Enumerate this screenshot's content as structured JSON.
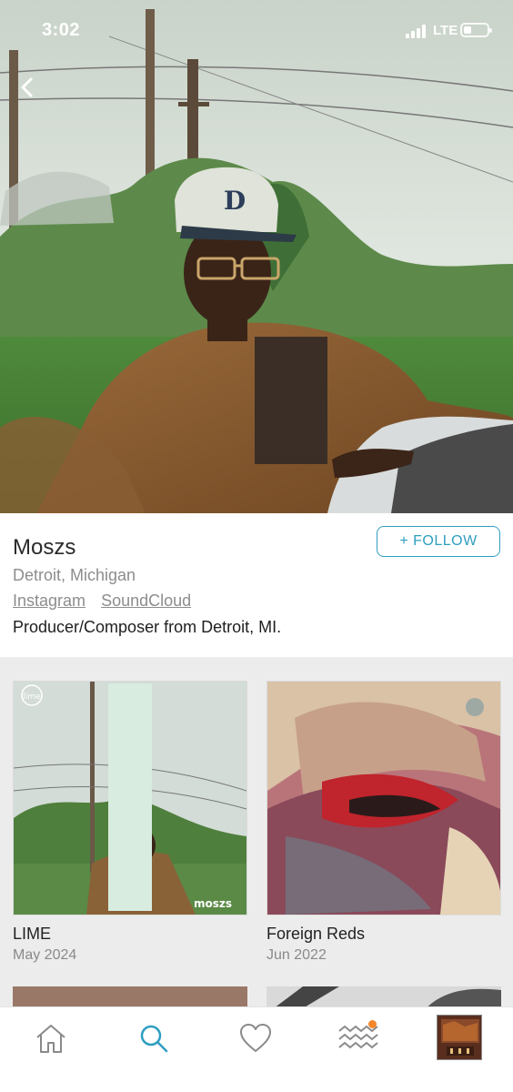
{
  "status_bar": {
    "time": "3:02",
    "network": "LTE"
  },
  "artist": {
    "name": "Moszs",
    "location": "Detroit, Michigan",
    "links": [
      "Instagram",
      "SoundCloud"
    ],
    "bio": "Producer/Composer from Detroit, MI.",
    "follow_label": "+ FOLLOW"
  },
  "releases": [
    {
      "title": "LIME",
      "date": "May 2024",
      "cover_brand": "moszs",
      "cover_badge": "lime"
    },
    {
      "title": "Foreign Reds",
      "date": "Jun 2022"
    }
  ],
  "tab_bar": {
    "tabs": [
      "home-icon",
      "search-icon",
      "heart-icon",
      "waves-icon",
      "now-playing"
    ],
    "active": "search-icon",
    "accent": "#2f9ec0",
    "notification_color": "#f5862b"
  }
}
